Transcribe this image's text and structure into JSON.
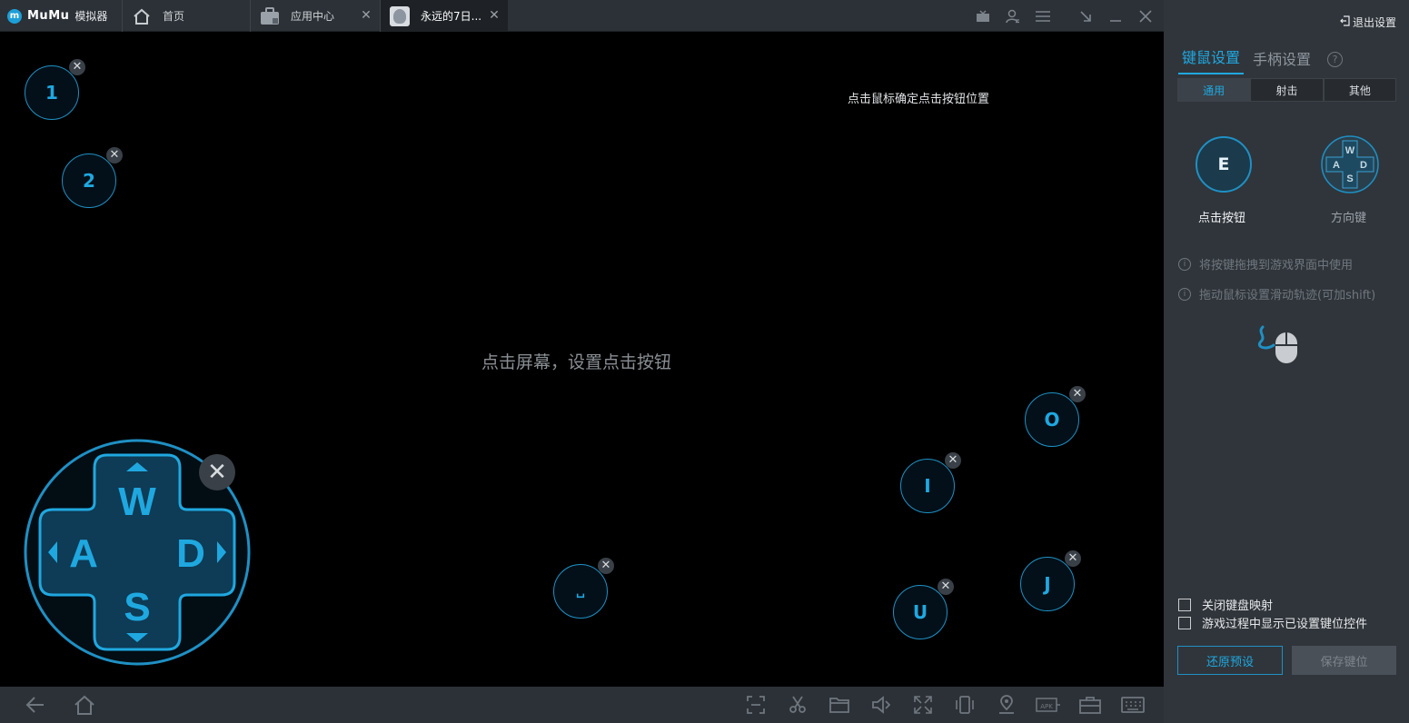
{
  "app": {
    "logo_text": "MuMu",
    "logo_sub": "模拟器"
  },
  "tabs": [
    {
      "label": "首页",
      "icon": "home-icon"
    },
    {
      "label": "应用中心",
      "icon": "app-store-icon"
    },
    {
      "label": "永远的7日...",
      "icon": "game-thumbnail"
    }
  ],
  "game_area": {
    "hint_top": "点击鼠标确定点击按钮位置",
    "hint_center": "点击屏幕，设置点击按钮",
    "keys": [
      "1",
      "2",
      "O",
      "I",
      "J",
      "U",
      "␣"
    ],
    "dpad": {
      "up": "W",
      "left": "A",
      "down": "S",
      "right": "D"
    }
  },
  "panel": {
    "exit_label": "退出设置",
    "tabs": [
      "键鼠设置",
      "手柄设置"
    ],
    "active_tab": "键鼠设置",
    "subtabs": [
      "通用",
      "射击",
      "其他"
    ],
    "active_subtab": "通用",
    "controls": {
      "click_key": "E",
      "click_label": "点击按钮",
      "direction_label": "方向键",
      "direction_keys": {
        "up": "W",
        "left": "A",
        "down": "S",
        "right": "D"
      }
    },
    "info": [
      "将按键拖拽到游戏界面中使用",
      "拖动鼠标设置滑动轨迹(可加shift)"
    ],
    "checkboxes": [
      {
        "label": "关闭键盘映射",
        "checked": false
      },
      {
        "label": "游戏过程中显示已设置键位控件",
        "checked": false
      }
    ],
    "buttons": {
      "restore": "还原预设",
      "save": "保存键位"
    }
  },
  "colors": {
    "accent": "#1fa8e0",
    "chrome": "#2c3137",
    "panel": "#30353b",
    "game_bg": "#000000"
  }
}
